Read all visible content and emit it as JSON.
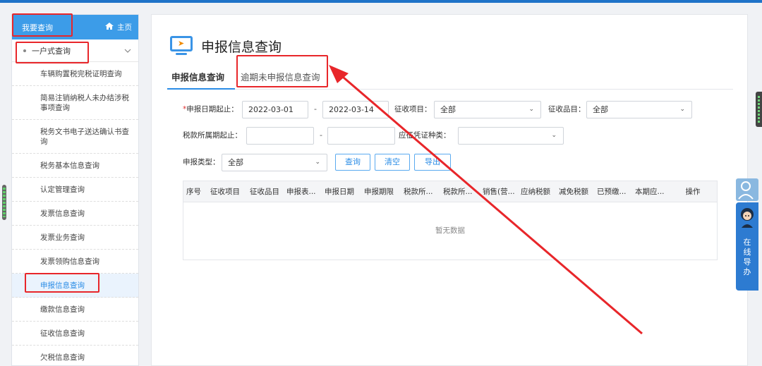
{
  "sidebar": {
    "title": "我要查询",
    "home_label": "主页",
    "group_label": "一户式查询",
    "items": [
      {
        "label": "车辆购置税完税证明查询",
        "active": false
      },
      {
        "label": "简易注销纳税人未办结涉税事项查询",
        "active": false
      },
      {
        "label": "税务文书电子送达确认书查询",
        "active": false
      },
      {
        "label": "税务基本信息查询",
        "active": false
      },
      {
        "label": "认定管理查询",
        "active": false
      },
      {
        "label": "发票信息查询",
        "active": false
      },
      {
        "label": "发票业务查询",
        "active": false
      },
      {
        "label": "发票领购信息查询",
        "active": false
      },
      {
        "label": "申报信息查询",
        "active": true
      },
      {
        "label": "缴款信息查询",
        "active": false
      },
      {
        "label": "征收信息查询",
        "active": false
      },
      {
        "label": "欠税信息查询",
        "active": false
      }
    ]
  },
  "page": {
    "title": "申报信息查询",
    "tabs": [
      {
        "label": "申报信息查询",
        "active": true
      },
      {
        "label": "逾期未申报信息查询",
        "active": false
      }
    ]
  },
  "form": {
    "required_mark": "*",
    "date_range_label": "申报日期起止：",
    "date_start": "2022-03-01",
    "date_end": "2022-03-14",
    "range_sep": "-",
    "item_label": "征收项目：",
    "item_value": "全部",
    "category_label": "征收品目：",
    "category_value": "全部",
    "period_label": "税款所属期起止：",
    "period_start": "",
    "period_end": "",
    "voucher_label": "应征凭证种类：",
    "voucher_value": "",
    "type_label": "申报类型：",
    "type_value": "全部",
    "query_button": "查询",
    "clear_button": "清空",
    "export_button": "导出"
  },
  "table": {
    "columns": [
      "序号",
      "征收项目",
      "征收品目",
      "申报表...",
      "申报日期",
      "申报期限",
      "税款所...",
      "税款所...",
      "销售(营...",
      "应纳税额",
      "减免税额",
      "已预缴...",
      "本期应...",
      "操作"
    ],
    "empty_text": "暂无数据"
  },
  "widgets": {
    "guide_text": "在线导办"
  },
  "annotation_color": "#e8262a"
}
